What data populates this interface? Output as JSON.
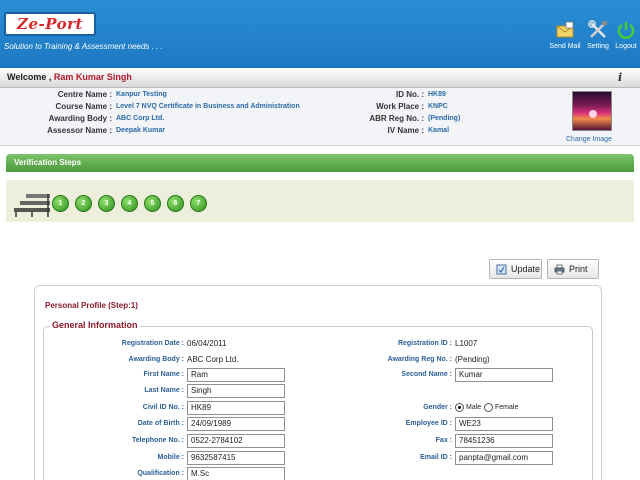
{
  "header": {
    "logo": "Ze-Port",
    "tagline": "Solution to Training & Assessment needs . . .",
    "buttons": [
      {
        "label": "Send Mail",
        "icon": "mail-icon"
      },
      {
        "label": "Setting",
        "icon": "tools-icon"
      },
      {
        "label": "Logout",
        "icon": "power-icon"
      }
    ]
  },
  "welcome": {
    "prefix": "Welcome ,",
    "name": "Ram Kumar Singh"
  },
  "info": {
    "left": [
      {
        "label": "Centre Name :",
        "value": "Kanpur Testing"
      },
      {
        "label": "Course Name :",
        "value": "Level 7 NVQ Certificate in Business and Administration"
      },
      {
        "label": "Awarding Body :",
        "value": "ABC Corp Ltd."
      },
      {
        "label": "Assessor Name :",
        "value": "Deepak Kumar"
      }
    ],
    "right": [
      {
        "label": "ID No. :",
        "value": "HK89"
      },
      {
        "label": "Work Place :",
        "value": "KNPC"
      },
      {
        "label": "ABR Reg No. :",
        "value": "(Pending)"
      },
      {
        "label": "IV Name :",
        "value": "Kamal"
      }
    ],
    "change_image": "Change Image"
  },
  "verification": {
    "title": "Verification Steps",
    "steps": [
      "1",
      "2",
      "3",
      "4",
      "5",
      "6",
      "7"
    ]
  },
  "actions": {
    "update": "Update",
    "print": "Print"
  },
  "profile": {
    "title": "Personal Profile (Step:1)",
    "section": "General Information",
    "registration_date": {
      "label": "Registration Date :",
      "value": "06/04/2011"
    },
    "registration_id": {
      "label": "Registration ID :",
      "value": "L1007"
    },
    "awarding_body": {
      "label": "Awarding Body :",
      "value": "ABC Corp Ltd."
    },
    "awarding_reg_no": {
      "label": "Awarding Reg No. :",
      "value": "(Pending)"
    },
    "first_name": {
      "label": "First Name :",
      "value": "Ram"
    },
    "second_name": {
      "label": "Second Name :",
      "value": "Kumar"
    },
    "last_name": {
      "label": "Last Name :",
      "value": "Singh"
    },
    "civil_id": {
      "label": "Civil ID No. :",
      "value": "HK89"
    },
    "gender": {
      "label": "Gender :",
      "options": [
        "Male",
        "Female"
      ],
      "selected": "Male"
    },
    "dob": {
      "label": "Date of Birth :",
      "value": "24/09/1989"
    },
    "employee_id": {
      "label": "Employee ID :",
      "value": "WE23"
    },
    "telephone": {
      "label": "Telephone No. :",
      "value": "0522-2784102"
    },
    "fax": {
      "label": "Fax :",
      "value": "78451236"
    },
    "mobile": {
      "label": "Mobile :",
      "value": "9632587415"
    },
    "email": {
      "label": "Email ID :",
      "value": "panpta@gmail.com"
    },
    "qualification": {
      "label": "Qualification :",
      "value": "M.Sc"
    }
  }
}
